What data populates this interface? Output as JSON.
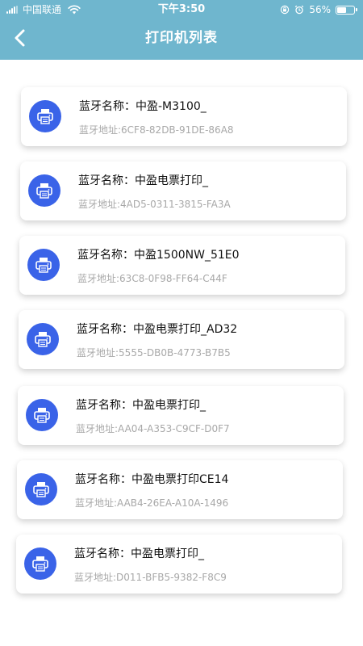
{
  "status_bar": {
    "carrier": "中国联通",
    "time": "下午3:50",
    "battery": "56%",
    "battery_level": 0.56
  },
  "header": {
    "title": "打印机列表"
  },
  "printers": [
    {
      "name": "蓝牙名称：中盈-M3100_",
      "address": "蓝牙地址:6CF8-82DB-91DE-86A8"
    },
    {
      "name": "蓝牙名称：中盈电票打印_",
      "address": "蓝牙地址:4AD5-0311-3815-FA3A"
    },
    {
      "name": "蓝牙名称：中盈1500NW_51E0",
      "address": "蓝牙地址:63C8-0F98-FF64-C44F"
    },
    {
      "name": "蓝牙名称：中盈电票打印_AD32",
      "address": "蓝牙地址:5555-DB0B-4773-B7B5"
    },
    {
      "name": "蓝牙名称：中盈电票打印_",
      "address": "蓝牙地址:AA04-A353-C9CF-D0F7"
    },
    {
      "name": "蓝牙名称：中盈电票打印CE14",
      "address": "蓝牙地址:AAB4-26EA-A10A-1496"
    },
    {
      "name": "蓝牙名称：中盈电票打印_",
      "address": "蓝牙地址:D011-BFB5-9382-F8C9"
    }
  ],
  "colors": {
    "header_bg": "#6fb6ce",
    "icon_bg": "#3a63e8",
    "address_text": "#a8a8a8"
  },
  "icons": {
    "printer": "printer-icon",
    "back": "back-arrow-icon"
  }
}
